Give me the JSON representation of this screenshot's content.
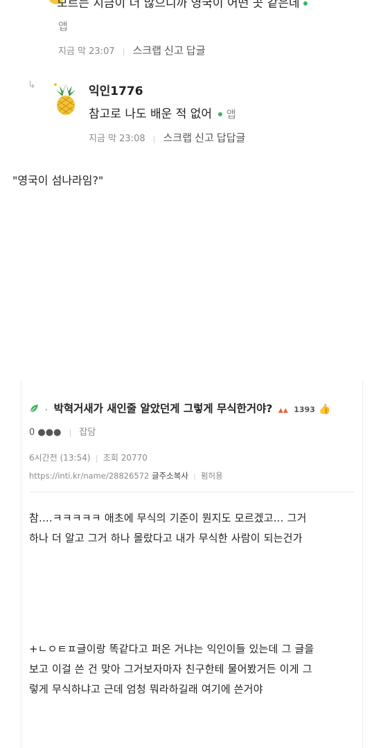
{
  "comment1": {
    "partial_text": "모르는 지금이 더 많으니까 영국이 어떤 곳 같은데",
    "source": "앱",
    "time": "지금 막 23:07",
    "actions": [
      "스크랩",
      "신고",
      "답글"
    ]
  },
  "reply": {
    "nickname": "익인1776",
    "text": "참고로 나도 배운 적 없어",
    "source": "앱",
    "time": "지금 막 23:08",
    "actions": [
      "스크랩",
      "신고",
      "답답글"
    ]
  },
  "quote": "\"영국이 섬나라임?\"",
  "post": {
    "title": "박혁거새가 새인줄 알았던게 그렇게 무식한거야?",
    "likes": "1393",
    "author": "0 ●●●",
    "category": "잡담",
    "time": "6시간전 (13:54)",
    "views": "조회 20770",
    "url": "https://inti.kr/name/28826572",
    "copy_url": "글주소복사",
    "permission": "펌허용",
    "paragraph1": [
      "참....ㅋㅋㅋㅋㅋ 애초에 무식의 기준이 뭔지도 모르겠고... 그거",
      "하나 더 알고 그거 하나 몰랐다고 내가 무식한 사람이 되는건가"
    ],
    "paragraph2": [
      "+ㄴㅇㅌㅍ글이랑 똑같다고 퍼온 거냐는 익인이들 있는데 그 글을",
      "보고 이걸 쓴 건 맞아 그거보자마자 친구한테 물어봤거든 이게 그",
      "렇게 무식하냐고 근데 엄청 뭐라하길래 여기에 쓴거야"
    ]
  },
  "colors": {
    "accent_green": "#3bb55a",
    "fire": "#e0643c"
  },
  "icons": [
    "reply-arrow-icon",
    "pineapple-avatar-icon",
    "leaf-icon",
    "fire-icon",
    "thumbs-up-icon",
    "green-dot-icon"
  ]
}
